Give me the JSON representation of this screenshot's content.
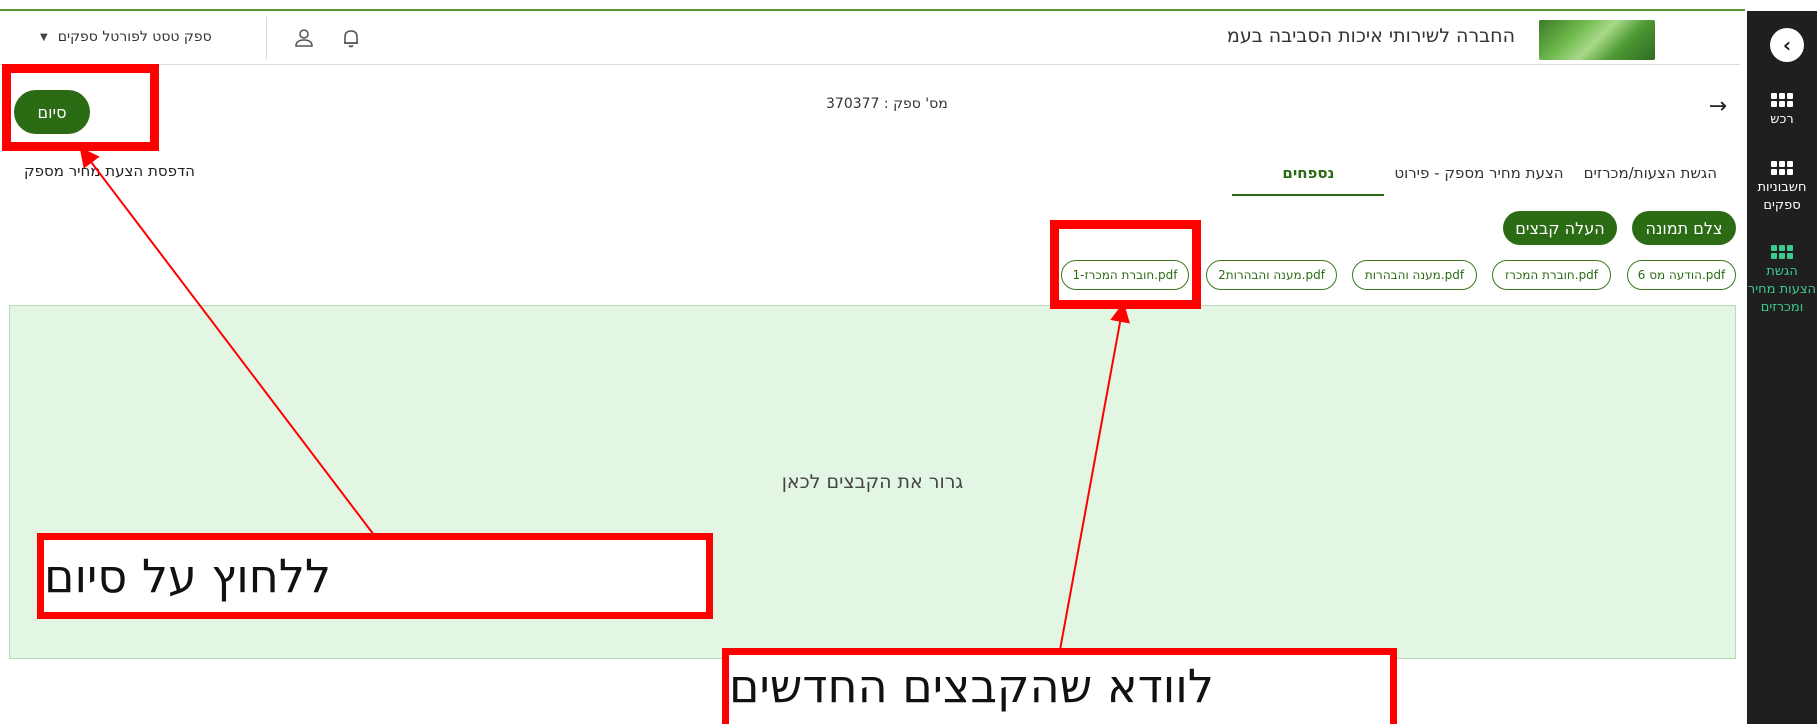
{
  "header": {
    "company_name": "החברה לשירותי איכות הסביבה בעמ",
    "user_menu_label": "ספק טסט לפורטל ספקים"
  },
  "sidebar": {
    "items": [
      {
        "label": "רכש"
      },
      {
        "label": "חשבוניות ספקים"
      },
      {
        "label": "הגשת הצעות מחיר ומכרזים"
      }
    ]
  },
  "main": {
    "supplier_number": "מס' ספק : 370377",
    "finish_button": "סיום",
    "print_link": "הדפסת הצעת מחיר מספק",
    "tabs": [
      {
        "label": "הגשת הצעות/מכרזים"
      },
      {
        "label": "הצעת מחיר מספק - פירוט"
      },
      {
        "label": "נספחים"
      }
    ],
    "active_tab": "נספחים",
    "take_photo_button": "צלם תמונה",
    "upload_files_button": "העלה קבצים",
    "files": [
      {
        "name": "הודעה מס 6.pdf"
      },
      {
        "name": "חוברת המכרז.pdf"
      },
      {
        "name": "מענה והבהרות.pdf"
      },
      {
        "name": "מענה והבהרות2.pdf"
      },
      {
        "name": "חוברת המכרז-1.pdf"
      }
    ],
    "dropzone_text": "גרור את הקבצים לכאן"
  },
  "annotations": {
    "callout_finish": "ללחוץ על סיום",
    "callout_files": "לוודא שהקבצים החדשים"
  },
  "colors": {
    "primary_green": "#2a6b14",
    "dropzone_bg": "#e3f6e3",
    "sidebar_bg": "#1f1f1f",
    "sidebar_active": "#3ec98e",
    "annotation_red": "#ff0000"
  }
}
